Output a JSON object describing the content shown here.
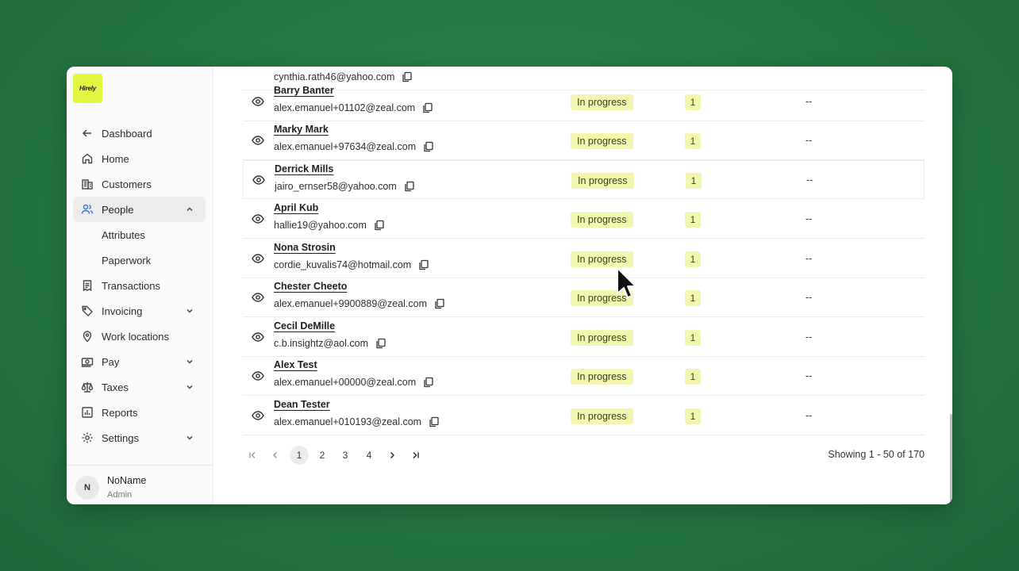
{
  "app": {
    "logo_text": "Hirely"
  },
  "sidebar": {
    "items": [
      {
        "label": "Dashboard",
        "icon": "arrow-left-icon"
      },
      {
        "label": "Home",
        "icon": "home-icon"
      },
      {
        "label": "Customers",
        "icon": "building-icon"
      },
      {
        "label": "People",
        "icon": "users-icon",
        "active": true,
        "expanded": true
      },
      {
        "label": "Attributes",
        "sub": true
      },
      {
        "label": "Paperwork",
        "sub": true
      },
      {
        "label": "Transactions",
        "icon": "receipt-icon"
      },
      {
        "label": "Invoicing",
        "icon": "tag-icon",
        "chevron": "down"
      },
      {
        "label": "Work locations",
        "icon": "location-pin-icon"
      },
      {
        "label": "Pay",
        "icon": "money-icon",
        "chevron": "down"
      },
      {
        "label": "Taxes",
        "icon": "scale-icon",
        "chevron": "down"
      },
      {
        "label": "Reports",
        "icon": "chart-icon"
      },
      {
        "label": "Settings",
        "icon": "gear-icon",
        "chevron": "down"
      }
    ]
  },
  "user": {
    "initial": "N",
    "name": "NoName",
    "role": "Admin"
  },
  "table": {
    "partial_row": {
      "email": "cynthia.rath46@yahoo.com"
    },
    "rows": [
      {
        "name": "Barry Banter",
        "email": "alex.emanuel+01102@zeal.com",
        "status": "In progress",
        "count": "1",
        "extra": "--"
      },
      {
        "name": "Marky Mark",
        "email": "alex.emanuel+97634@zeal.com",
        "status": "In progress",
        "count": "1",
        "extra": "--"
      },
      {
        "name": "Derrick Mills",
        "email": "jairo_ernser58@yahoo.com",
        "status": "In progress",
        "count": "1",
        "extra": "--"
      },
      {
        "name": "April Kub",
        "email": "hallie19@yahoo.com",
        "status": "In progress",
        "count": "1",
        "extra": "--"
      },
      {
        "name": "Nona Strosin",
        "email": "cordie_kuvalis74@hotmail.com",
        "status": "In progress",
        "count": "1",
        "extra": "--"
      },
      {
        "name": "Chester Cheeto",
        "email": "alex.emanuel+9900889@zeal.com",
        "status": "In progress",
        "count": "1",
        "extra": "--"
      },
      {
        "name": "Cecil DeMille",
        "email": "c.b.insightz@aol.com",
        "status": "In progress",
        "count": "1",
        "extra": "--"
      },
      {
        "name": "Alex Test",
        "email": "alex.emanuel+00000@zeal.com",
        "status": "In progress",
        "count": "1",
        "extra": "--"
      },
      {
        "name": "Dean Tester",
        "email": "alex.emanuel+010193@zeal.com",
        "status": "In progress",
        "count": "1",
        "extra": "--"
      }
    ]
  },
  "pagination": {
    "pages": [
      "1",
      "2",
      "3",
      "4"
    ],
    "current": "1",
    "showing": "Showing 1 - 50 of 170"
  },
  "colors": {
    "background": "#267a42",
    "logo_bg": "#e4f542",
    "badge_bg": "#f2f6ae",
    "active_nav_bg": "#ececec",
    "people_icon": "#3b6ee0"
  }
}
